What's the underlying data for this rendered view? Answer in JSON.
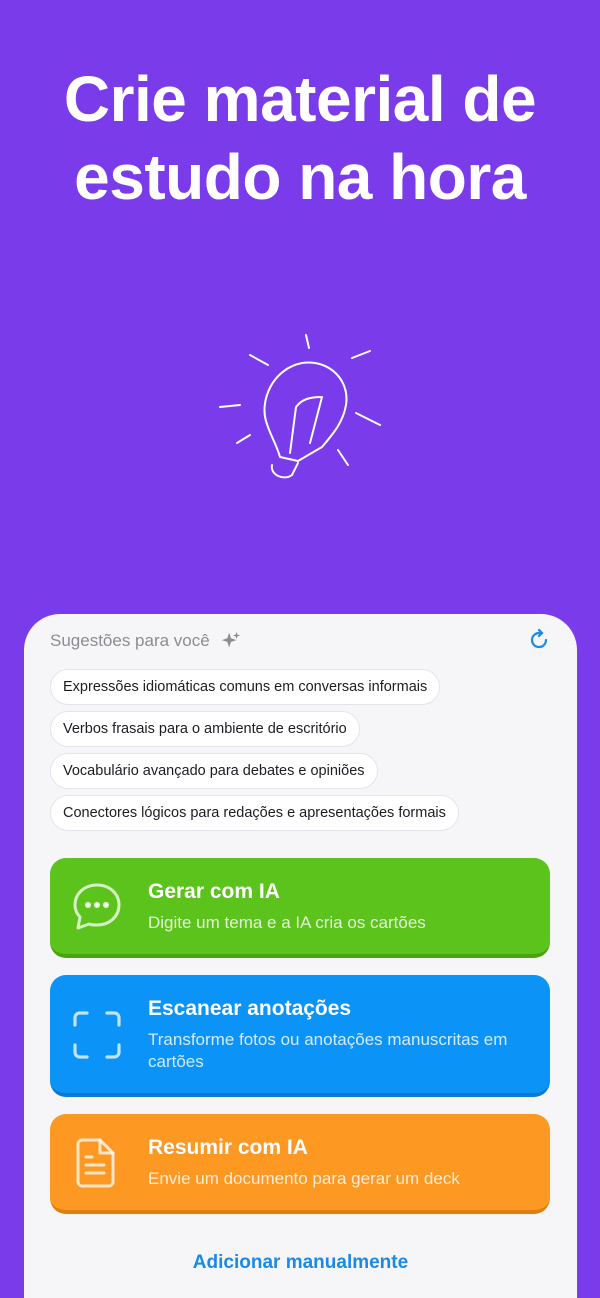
{
  "hero": {
    "title_line1": "Crie material de",
    "title_line2": "estudo na hora"
  },
  "suggestions": {
    "heading": "Sugestões para você",
    "items": [
      "Expressões idiomáticas comuns em conversas informais",
      "Verbos frasais para o ambiente de escritório",
      "Vocabulário avançado para debates e opiniões",
      "Conectores lógicos para redações e apresentações formais"
    ]
  },
  "actions": {
    "generate": {
      "title": "Gerar com IA",
      "subtitle": "Digite um tema e a IA cria os cartões",
      "icon": "chat-bubble-icon"
    },
    "scan": {
      "title": "Escanear anotações",
      "subtitle": "Transforme fotos ou anotações manuscritas em cartões",
      "icon": "scan-frame-icon"
    },
    "summarize": {
      "title": "Resumir com IA",
      "subtitle": "Envie um documento para gerar um deck",
      "icon": "document-icon"
    }
  },
  "manual_link": "Adicionar manualmente",
  "colors": {
    "background": "#7a3bea",
    "green": "#5cc21c",
    "blue": "#0b93f7",
    "orange": "#fd9823",
    "link": "#1a8ae8"
  }
}
